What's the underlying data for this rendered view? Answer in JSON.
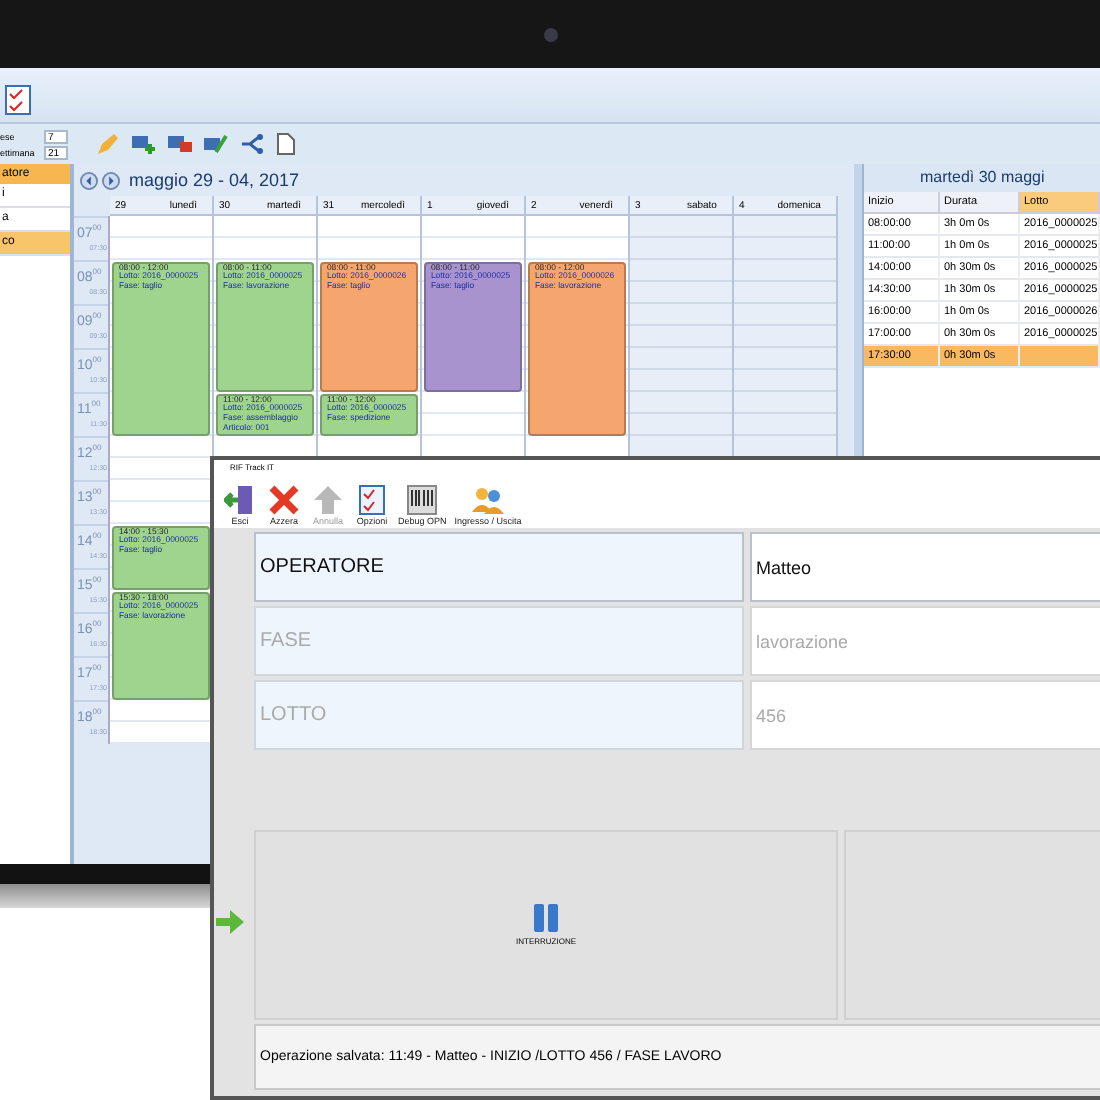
{
  "app": {
    "sidebar": {
      "spinners": [
        {
          "label": "ese",
          "value": "7"
        },
        {
          "label": "ettimana",
          "value": "21"
        }
      ],
      "list_header": "atore",
      "items": [
        {
          "label": "i",
          "selected": false
        },
        {
          "label": "a",
          "selected": false
        },
        {
          "label": "co",
          "selected": true
        }
      ]
    },
    "calendar": {
      "title": "maggio 29 - 04, 2017",
      "hours": [
        {
          "hour": "07$^{00}$",
          "half": "07:30"
        },
        {
          "hour": "08$^{00}$",
          "half": "08:30"
        },
        {
          "hour": "09$^{00}$",
          "half": "09:30"
        },
        {
          "hour": "10$^{00}$",
          "half": "10:30"
        },
        {
          "hour": "11$^{00}$",
          "half": "11:30"
        },
        {
          "hour": "12$^{00}$",
          "half": "12:30"
        },
        {
          "hour": "13$^{00}$",
          "half": "13:30"
        },
        {
          "hour": "14$^{00}$",
          "half": "14:30"
        },
        {
          "hour": "15$^{00}$",
          "half": "15:30"
        },
        {
          "hour": "16$^{00}$",
          "half": "16:30"
        },
        {
          "hour": "17$^{00}$",
          "half": "17:30"
        },
        {
          "hour": "18$^{00}$",
          "half": "18:30"
        }
      ],
      "days": [
        {
          "number": "29",
          "name": "lunedì",
          "weekend": false,
          "events": [
            {
              "time": "08:00 - 12:00",
              "lines": [
                "Lotto: 2016_0000025",
                "Fase: taglio"
              ],
              "color": "#9fd48f"
            },
            {
              "time": "14:00 - 15:30",
              "lines": [
                "Lotto: 2016_0000025",
                "Fase: taglio"
              ],
              "color": "#9fd48f"
            },
            {
              "time": "15:30 - 18:00",
              "lines": [
                "Lotto: 2016_0000025",
                "Fase: lavorazione"
              ],
              "color": "#9fd48f"
            }
          ]
        },
        {
          "number": "30",
          "name": "martedì",
          "weekend": false,
          "events": [
            {
              "time": "08:00 - 11:00",
              "lines": [
                "Lotto: 2016_0000025",
                "Fase: lavorazione"
              ],
              "color": "#9fd48f"
            },
            {
              "time": "11:00 - 12:00",
              "lines": [
                "Lotto: 2016_0000025",
                "Fase: assemblaggio",
                "Articolo: 001"
              ],
              "color": "#9fd48f"
            }
          ]
        },
        {
          "number": "31",
          "name": "mercoledì",
          "weekend": false,
          "events": [
            {
              "time": "08:00 - 11:00",
              "lines": [
                "Lotto: 2016_0000026",
                "Fase: taglio"
              ],
              "color": "#f5a56e"
            },
            {
              "time": "11:00 - 12:00",
              "lines": [
                "Lotto: 2016_0000025",
                "Fase: spedizione"
              ],
              "color": "#9fd48f"
            }
          ]
        },
        {
          "number": "1",
          "name": "giovedì",
          "weekend": false,
          "events": [
            {
              "time": "08:00 - 11:00",
              "lines": [
                "Lotto: 2016_0000025",
                "Fase: taglio"
              ],
              "color": "#a993cf"
            }
          ]
        },
        {
          "number": "2",
          "name": "venerdì",
          "weekend": false,
          "events": [
            {
              "time": "08:00 - 12:00",
              "lines": [
                "Lotto: 2016_0000026",
                "Fase: lavorazione"
              ],
              "color": "#f5a56e"
            }
          ]
        },
        {
          "number": "3",
          "name": "sabato",
          "weekend": true
        },
        {
          "number": "4",
          "name": "domenica",
          "weekend": true
        }
      ]
    },
    "day_panel": {
      "title": "martedì 30 maggi",
      "columns": [
        {
          "label": "Inizio",
          "selected": false
        },
        {
          "label": "Durata",
          "selected": false
        },
        {
          "label": "Lotto",
          "selected": true
        }
      ],
      "rows": [
        {
          "cells": [
            "08:00:00",
            "3h 0m 0s",
            "2016_0000025"
          ],
          "selected": false
        },
        {
          "cells": [
            "11:00:00",
            "1h 0m 0s",
            "2016_0000025"
          ],
          "selected": false
        },
        {
          "cells": [
            "14:00:00",
            "0h 30m 0s",
            "2016_0000025"
          ],
          "selected": false
        },
        {
          "cells": [
            "14:30:00",
            "1h 30m 0s",
            "2016_0000025"
          ],
          "selected": false
        },
        {
          "cells": [
            "16:00:00",
            "1h 0m 0s",
            "2016_0000026"
          ],
          "selected": false
        },
        {
          "cells": [
            "17:00:00",
            "0h 30m 0s",
            "2016_0000025"
          ],
          "selected": false
        },
        {
          "cells": [
            "17:30:00",
            "0h 30m 0s"
          ],
          "selected": true
        }
      ]
    }
  },
  "dialog": {
    "title": "RIF Track IT",
    "toolbar": [
      {
        "kind": "exit",
        "label": "Esci",
        "disabled": false
      },
      {
        "kind": "reset",
        "label": "Azzera",
        "disabled": false
      },
      {
        "kind": "undo",
        "label": "Annulla",
        "disabled": true
      },
      {
        "kind": "options",
        "label": "Opzioni",
        "disabled": false
      },
      {
        "kind": "barcode",
        "label": "Debug OPN",
        "disabled": false
      },
      {
        "kind": "users",
        "label": "Ingresso / Uscita",
        "disabled": false
      }
    ],
    "fields": [
      {
        "label": "OPERATORE",
        "value": "Matteo",
        "active": true
      },
      {
        "label": "FASE",
        "value": "lavorazione",
        "active": false
      },
      {
        "label": "LOTTO",
        "value": "456",
        "active": false
      }
    ],
    "actions": [
      {
        "kind": "pause",
        "label": "INTERRUZIONE"
      },
      {
        "kind": "blank"
      }
    ],
    "status": "Operazione salvata: 11:49 - Matteo - INIZIO  /LOTTO 456 / FASE LAVORO"
  }
}
